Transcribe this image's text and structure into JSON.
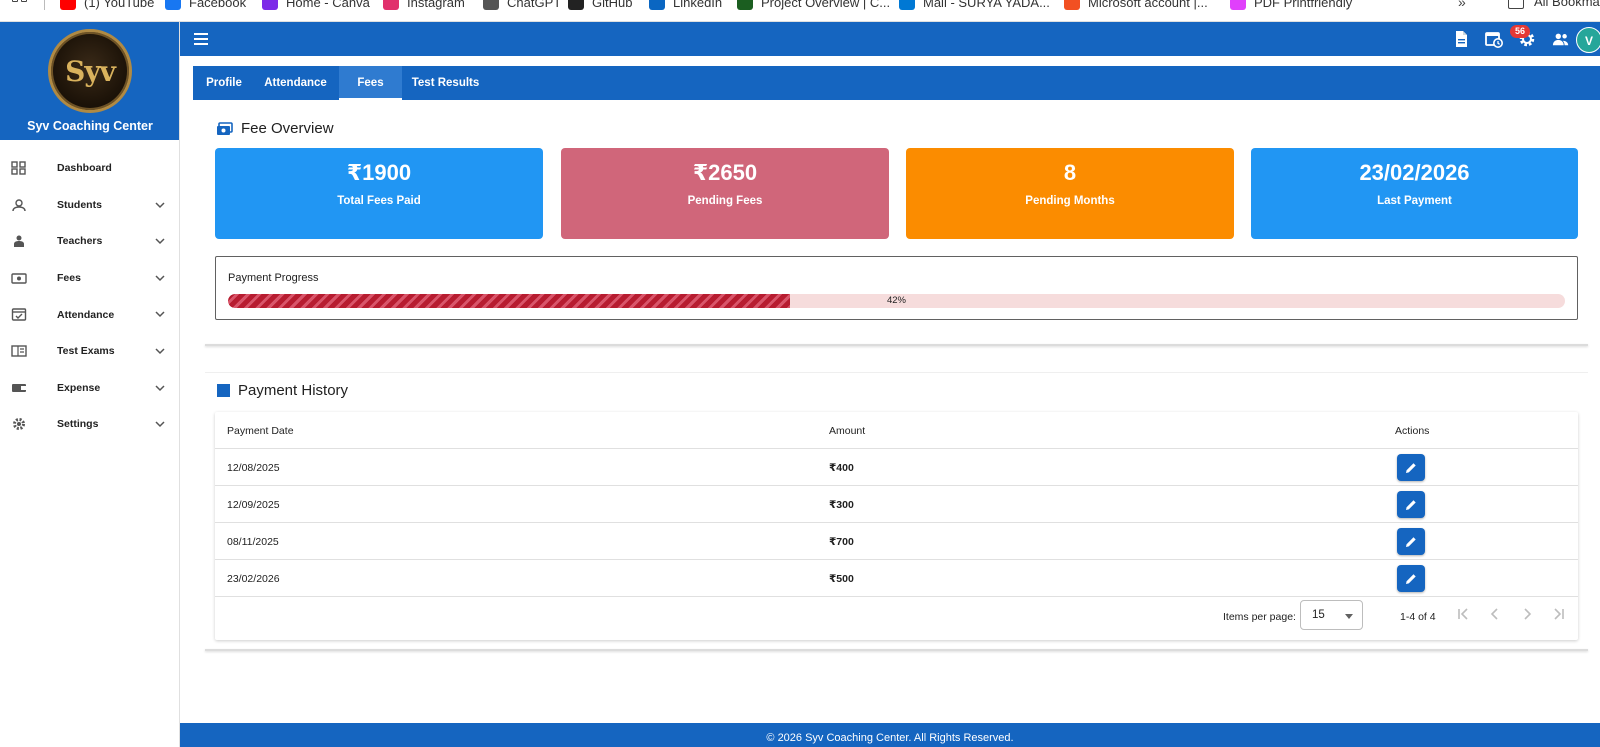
{
  "bookmarks": [
    {
      "label": "(1) YouTube",
      "color": "#ff0000"
    },
    {
      "label": "Facebook",
      "color": "#1877f2"
    },
    {
      "label": "Home - Canva",
      "color": "#7d2ae8"
    },
    {
      "label": "Instagram",
      "color": "#e1306c"
    },
    {
      "label": "ChatGPT",
      "color": "#555555"
    },
    {
      "label": "GitHub",
      "color": "#222222"
    },
    {
      "label": "LinkedIn",
      "color": "#0a66c2"
    },
    {
      "label": "Project Overview | C...",
      "color": "#1b5e20"
    },
    {
      "label": "Mail - SURYA YADA...",
      "color": "#0078d4"
    },
    {
      "label": "Microsoft account |...",
      "color": "#f25022"
    },
    {
      "label": "PDF Printfriendly",
      "color": "#e040fb"
    }
  ],
  "bookmarks_more": "»",
  "bookmarks_all": "All Bookmarks",
  "brand": {
    "name": "Syv Coaching Center",
    "logo_text": "Syv"
  },
  "sidebar": {
    "items": [
      {
        "label": "Dashboard",
        "icon": "dashboard-icon",
        "expandable": false
      },
      {
        "label": "Students",
        "icon": "student-icon",
        "expandable": true
      },
      {
        "label": "Teachers",
        "icon": "teacher-icon",
        "expandable": true
      },
      {
        "label": "Fees",
        "icon": "money-icon",
        "expandable": true
      },
      {
        "label": "Attendance",
        "icon": "calendar-check-icon",
        "expandable": true
      },
      {
        "label": "Test Exams",
        "icon": "exam-icon",
        "expandable": true
      },
      {
        "label": "Expense",
        "icon": "wallet-icon",
        "expandable": true
      },
      {
        "label": "Settings",
        "icon": "gear-icon",
        "expandable": true
      }
    ]
  },
  "header": {
    "icons": [
      "document-icon",
      "calendar-clock-icon",
      "gear-icon",
      "group-icon"
    ],
    "notification_count": "56",
    "avatar_initial": "V"
  },
  "tabs": [
    {
      "label": "Profile",
      "active": false
    },
    {
      "label": "Attendance",
      "active": false
    },
    {
      "label": "Fees",
      "active": true
    },
    {
      "label": "Test Results",
      "active": false
    }
  ],
  "fee_overview": {
    "title": "Fee Overview",
    "cards": [
      {
        "value": "₹1900",
        "label": "Total Fees Paid",
        "color": "#2196f3"
      },
      {
        "value": "₹2650",
        "label": "Pending Fees",
        "color": "#d0667a"
      },
      {
        "value": "8",
        "label": "Pending Months",
        "color": "#fb8c00"
      },
      {
        "value": "23/02/2026",
        "label": "Last Payment",
        "color": "#2196f3"
      }
    ],
    "progress": {
      "title": "Payment Progress",
      "percent": 42,
      "label": "42%"
    }
  },
  "payment_history": {
    "title": "Payment History",
    "columns": [
      "Payment Date",
      "Amount",
      "Actions"
    ],
    "rows": [
      {
        "date": "12/08/2025",
        "amount": "₹400"
      },
      {
        "date": "12/09/2025",
        "amount": "₹300"
      },
      {
        "date": "08/11/2025",
        "amount": "₹700"
      },
      {
        "date": "23/02/2026",
        "amount": "₹500"
      }
    ],
    "paginator": {
      "items_per_page_label": "Items per page:",
      "page_size": "15",
      "range": "1-4 of 4"
    }
  },
  "footer": {
    "text": "© 2026 Syv Coaching Center. All Rights Reserved."
  },
  "colors": {
    "primary": "#1565c0",
    "accent_blue": "#2196f3",
    "danger": "#b71c30"
  }
}
